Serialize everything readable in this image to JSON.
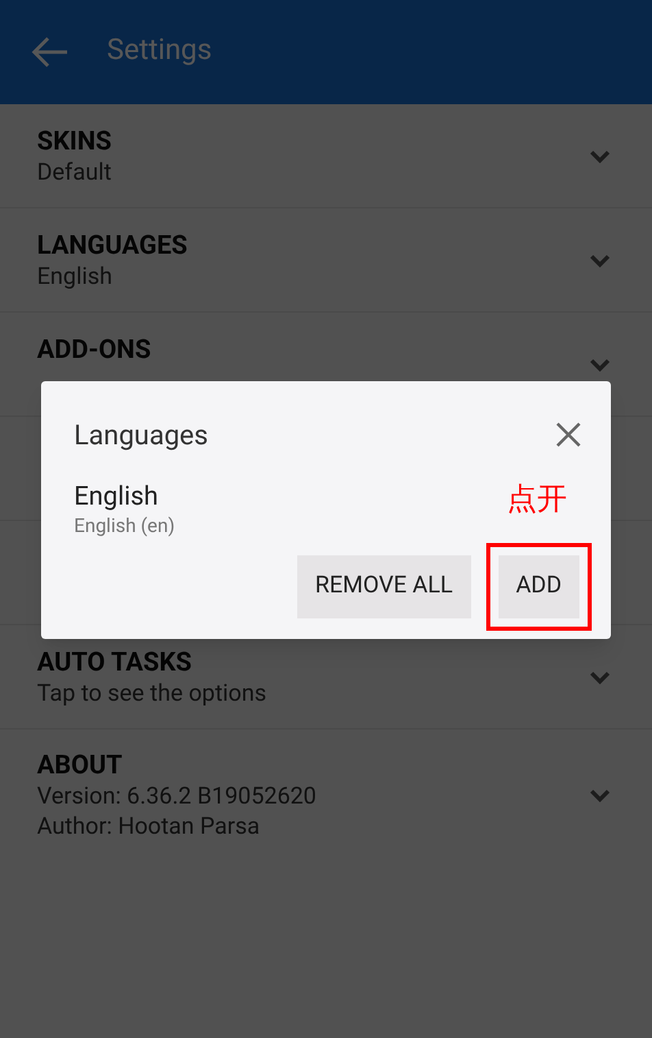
{
  "app_bar": {
    "title": "Settings"
  },
  "settings": [
    {
      "title": "SKINS",
      "lines": [
        "Default"
      ]
    },
    {
      "title": "LANGUAGES",
      "lines": [
        "English"
      ]
    },
    {
      "title": "ADD-ONS"
    }
  ],
  "settings_below_dialog": [
    {
      "title": "AUTO TASKS",
      "lines": [
        "Tap to see the options"
      ]
    },
    {
      "title": "ABOUT",
      "lines": [
        "Version: 6.36.2  B19052620",
        "Author: Hootan Parsa"
      ]
    }
  ],
  "dialog": {
    "title": "Languages",
    "language": {
      "name": "English",
      "detail": "English (en)"
    },
    "buttons": [
      "REMOVE ALL",
      "ADD"
    ]
  },
  "annotation": {
    "text": "点开"
  }
}
